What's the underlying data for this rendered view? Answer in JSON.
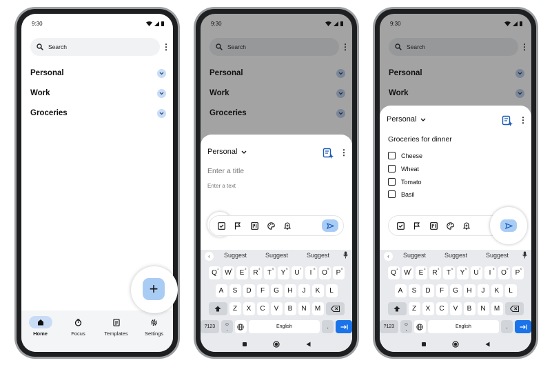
{
  "status": {
    "time": "9:30"
  },
  "search": {
    "placeholder": "Search"
  },
  "categories": [
    {
      "label": "Personal"
    },
    {
      "label": "Work"
    },
    {
      "label": "Groceries"
    }
  ],
  "nav": [
    {
      "label": "Home",
      "icon": "home-icon"
    },
    {
      "label": "Focus",
      "icon": "timer-icon"
    },
    {
      "label": "Templates",
      "icon": "document-icon"
    },
    {
      "label": "Settings",
      "icon": "gear-icon"
    }
  ],
  "sheet": {
    "category": "Personal",
    "title_placeholder": "Enter a title",
    "text_placeholder": "Enter a text",
    "filled_title": "Groceries for dinner",
    "checklist": [
      "Cheese",
      "Wheat",
      "Tomato",
      "Basil"
    ]
  },
  "keyboard": {
    "suggestions": [
      "Suggest",
      "Suggest",
      "Suggest"
    ],
    "row1": [
      "Q",
      "W",
      "E",
      "R",
      "T",
      "Y",
      "U",
      "I",
      "O",
      "P"
    ],
    "row1_nums": [
      "1",
      "2",
      "3",
      "4",
      "5",
      "6",
      "7",
      "8",
      "9",
      "0"
    ],
    "row2": [
      "A",
      "S",
      "D",
      "F",
      "G",
      "H",
      "J",
      "K",
      "L"
    ],
    "row3": [
      "Z",
      "X",
      "C",
      "V",
      "B",
      "N",
      "M"
    ],
    "sym_label": "?123",
    "space_label": "English",
    "period": ".",
    "comma": ","
  },
  "colors": {
    "accent": "#a9ccf5",
    "enter": "#1a73e8",
    "chip": "#c9dcf6"
  }
}
